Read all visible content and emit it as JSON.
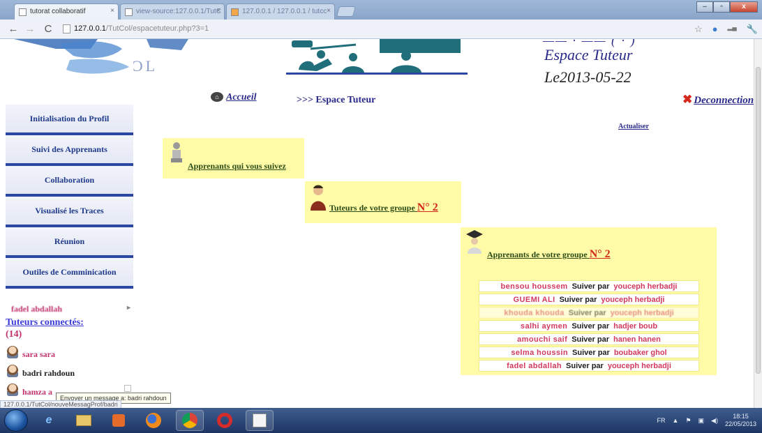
{
  "browser": {
    "tabs": [
      {
        "label": "tutorat collaboratif",
        "active": true
      },
      {
        "label": "view-source:127.0.0.1/TutC",
        "active": false
      },
      {
        "label": "127.0.0.1 / 127.0.0.1 / tutcc",
        "active": false
      }
    ],
    "url_host": "127.0.0.1",
    "url_path": "/TutCol/espacetuteur.php?3=1"
  },
  "header": {
    "title_line": "Espace Tuteur",
    "date": "Le2013-05-22"
  },
  "topnav": {
    "accueil": "Accueil",
    "breadcrumb": ">>> Espace Tuteur",
    "deconnexion": "Deconnection"
  },
  "sidebar": {
    "items": [
      {
        "label": "Initialisation du Profil"
      },
      {
        "label": "Suivi des Apprenants"
      },
      {
        "label": "Collaboration"
      },
      {
        "label": "Visualisé les Traces"
      },
      {
        "label": "Réunion"
      },
      {
        "label": "Outiles de Comminication"
      }
    ],
    "scrolling_name": "fadel abdallah",
    "tuteurs_label": "Tuteurs connectés:",
    "tuteurs_count": "(14)",
    "connected": [
      {
        "name": "sara sara",
        "color": "#c0336b"
      },
      {
        "name": "badri rahdoun",
        "color": "#222222"
      },
      {
        "name": "hamza a",
        "color": "#c0336b"
      }
    ]
  },
  "content": {
    "actualiser": "Actualiser",
    "box1_link": "Apprenants qui vous suivez",
    "box2_link": "Tuteurs de votre groupe",
    "box2_num": "N° 2",
    "box3_link": "Apprenants de votre groupe",
    "box3_num": "N° 2",
    "suivi_label": "Suiver par",
    "pairs": [
      {
        "apprenant": "bensou houssem",
        "tuteur": "youceph herbadji"
      },
      {
        "apprenant": "GUEMI ALI",
        "tuteur": "youceph herbadji"
      },
      {
        "apprenant": "khouda khouda",
        "tuteur": "youceph herbadji"
      },
      {
        "apprenant": "salhi aymen",
        "tuteur": "hadjer boub"
      },
      {
        "apprenant": "amouchi saif",
        "tuteur": "hanen hanen"
      },
      {
        "apprenant": "selma houssin",
        "tuteur": "boubaker ghol"
      },
      {
        "apprenant": "fadel abdallah",
        "tuteur": "youceph herbadji"
      }
    ]
  },
  "tooltip": "Envoyer un message a: badri rahdoun",
  "status_url": "127.0.0.1/TutCol/nouveMessagProf/badri",
  "taskbar": {
    "lang": "FR",
    "time": "18:15",
    "date": "22/05/2013"
  },
  "colors": {
    "sidebar_border": "#2c47a1",
    "yellow_box": "#fffba6",
    "link_blue": "#2a2a8a",
    "name_pink": "#c0336b"
  }
}
